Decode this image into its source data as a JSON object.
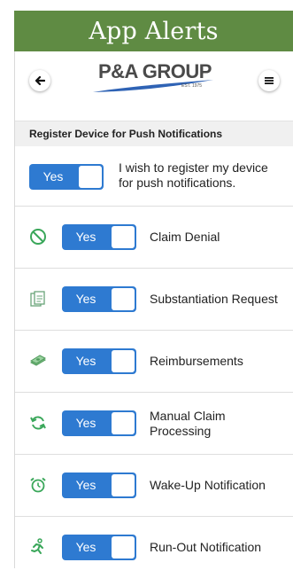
{
  "app": {
    "title": "App Alerts"
  },
  "header": {
    "logo_text": "P&A GROUP",
    "logo_est": "EST. 1975",
    "back_icon": "arrow-left-icon",
    "menu_icon": "menu-icon"
  },
  "section": {
    "title": "Register Device for Push Notifications"
  },
  "register": {
    "toggle_label": "Yes",
    "enabled": true,
    "text": "I wish to register my device for push notifications."
  },
  "alerts": [
    {
      "label": "Claim Denial",
      "toggle_label": "Yes",
      "enabled": true,
      "icon": "no-entry-icon"
    },
    {
      "label": "Substantiation Request",
      "toggle_label": "Yes",
      "enabled": true,
      "icon": "documents-icon"
    },
    {
      "label": "Reimbursements",
      "toggle_label": "Yes",
      "enabled": true,
      "icon": "money-icon"
    },
    {
      "label": "Manual Claim Processing",
      "toggle_label": "Yes",
      "enabled": true,
      "icon": "refresh-icon"
    },
    {
      "label": "Wake-Up Notification",
      "toggle_label": "Yes",
      "enabled": true,
      "icon": "alarm-clock-icon"
    },
    {
      "label": "Run-Out Notification",
      "toggle_label": "Yes",
      "enabled": true,
      "icon": "runner-icon"
    }
  ],
  "colors": {
    "title_bar": "#5f8b43",
    "toggle_on": "#2e7ad1",
    "icon_green": "#3aa75a",
    "section_bg": "#f0f0f0"
  }
}
